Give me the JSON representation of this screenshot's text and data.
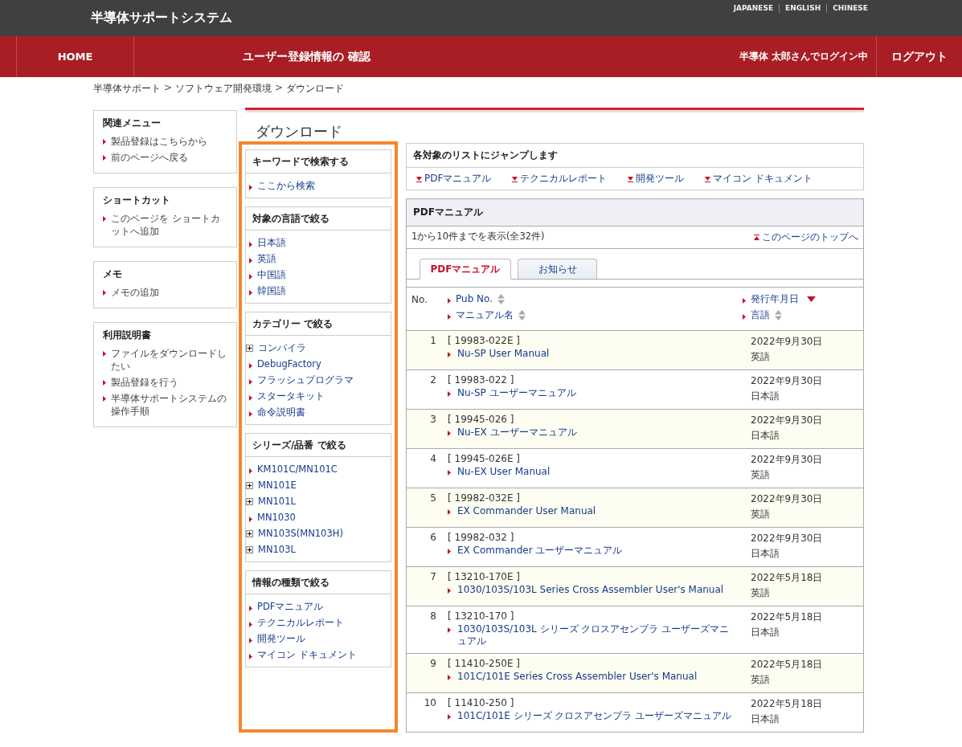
{
  "header": {
    "title": "半導体サポートシステム",
    "languages": [
      "JAPANESE",
      "ENGLISH",
      "CHINESE"
    ]
  },
  "nav": {
    "home": "HOME",
    "page_title": "ユーザー登録情報の 確認",
    "user_status": "半導体 太郎さんでログイン中",
    "logout": "ログアウト"
  },
  "breadcrumb": [
    {
      "label": "半導体サポート",
      "separator": ">"
    },
    {
      "label": "ソフトウェア開発環境",
      "separator": ">"
    },
    {
      "label": "ダウンロード"
    }
  ],
  "sidebar_boxes": [
    {
      "title": "関連メニュー",
      "items": [
        "製品登録はこちらから",
        "前のページへ戻る"
      ]
    },
    {
      "title": "ショートカット",
      "items": [
        "このページを ショートカットへ追加"
      ]
    },
    {
      "title": "メモ",
      "items": [
        "メモの追加"
      ]
    },
    {
      "title": "利用説明書",
      "items": [
        "ファイルをダウンロードしたい",
        "製品登録を行う",
        "半導体サポートシステムの操作手順"
      ]
    }
  ],
  "page_heading": "ダウンロード",
  "filters": [
    {
      "title": "キーワードで検索する",
      "items": [
        {
          "label": "ここから検索",
          "expandable": false
        }
      ]
    },
    {
      "title": "対象の言語で絞る",
      "items": [
        {
          "label": "日本語",
          "expandable": false
        },
        {
          "label": "英語",
          "expandable": false
        },
        {
          "label": "中国語",
          "expandable": false
        },
        {
          "label": "韓国語",
          "expandable": false
        }
      ]
    },
    {
      "title": "カテゴリー で絞る",
      "items": [
        {
          "label": "コンパイラ",
          "expandable": true
        },
        {
          "label": "DebugFactory",
          "expandable": false
        },
        {
          "label": "フラッシュプログラマ",
          "expandable": false
        },
        {
          "label": "スタータキット",
          "expandable": false
        },
        {
          "label": "命令説明書",
          "expandable": false
        }
      ]
    },
    {
      "title": "シリーズ/品番 で絞る",
      "items": [
        {
          "label": "KM101C/MN101C",
          "expandable": false
        },
        {
          "label": "MN101E",
          "expandable": true
        },
        {
          "label": "MN101L",
          "expandable": true
        },
        {
          "label": "MN1030",
          "expandable": false
        },
        {
          "label": "MN103S(MN103H)",
          "expandable": true
        },
        {
          "label": "MN103L",
          "expandable": true
        }
      ]
    },
    {
      "title": "情報の種類で絞る",
      "items": [
        {
          "label": "PDFマニュアル",
          "expandable": false
        },
        {
          "label": "テクニカルレポート",
          "expandable": false
        },
        {
          "label": "開発ツール",
          "expandable": false
        },
        {
          "label": "マイコン ドキュメント",
          "expandable": false
        }
      ]
    }
  ],
  "jump_box": {
    "title": "各対象のリストにジャンプします",
    "links": [
      "PDFマニュアル",
      "テクニカルレポート",
      "開発ツール",
      "マイコン ドキュメント"
    ]
  },
  "list_panel": {
    "title": "PDFマニュアル",
    "count": "1から10件までを表示(全32件)",
    "top_link": "このページのトップへ",
    "tabs": [
      {
        "label": "PDFマニュアル",
        "selected": true
      },
      {
        "label": "お知らせ",
        "selected": false
      }
    ],
    "no_column": "No.",
    "sort_columns": [
      {
        "label": "Pub No.",
        "sorted": false
      },
      {
        "label": "マニュアル名",
        "sorted": false
      },
      {
        "label": "発行年月日",
        "sorted": true
      },
      {
        "label": "言語",
        "sorted": false
      }
    ]
  },
  "rows": [
    {
      "no": "1",
      "pub_no": "[ 19983-022E ]",
      "name": "Nu-SP User Manual",
      "date": "2022年9月30日",
      "language": "英語"
    },
    {
      "no": "2",
      "pub_no": "[ 19983-022 ]",
      "name": "Nu-SP ユーザーマニュアル",
      "date": "2022年9月30日",
      "language": "日本語"
    },
    {
      "no": "3",
      "pub_no": "[ 19945-026 ]",
      "name": "Nu-EX ユーザーマニュアル",
      "date": "2022年9月30日",
      "language": "日本語"
    },
    {
      "no": "4",
      "pub_no": "[ 19945-026E ]",
      "name": "Nu-EX User Manual",
      "date": "2022年9月30日",
      "language": "英語"
    },
    {
      "no": "5",
      "pub_no": "[ 19982-032E ]",
      "name": "EX Commander User Manual",
      "date": "2022年9月30日",
      "language": "英語"
    },
    {
      "no": "6",
      "pub_no": "[ 19982-032 ]",
      "name": "EX Commander ユーザーマニュアル",
      "date": "2022年9月30日",
      "language": "日本語"
    },
    {
      "no": "7",
      "pub_no": "[ 13210-170E ]",
      "name": "1030/103S/103L Series Cross Assembler User's Manual",
      "date": "2022年5月18日",
      "language": "英語"
    },
    {
      "no": "8",
      "pub_no": "[ 13210-170 ]",
      "name": "1030/103S/103L シリーズ クロスアセンブラ ユーザーズマニュアル",
      "date": "2022年5月18日",
      "language": "日本語"
    },
    {
      "no": "9",
      "pub_no": "[ 11410-250E ]",
      "name": "101C/101E Series Cross Assembler User's Manual",
      "date": "2022年5月18日",
      "language": "英語"
    },
    {
      "no": "10",
      "pub_no": "[ 11410-250 ]",
      "name": "101C/101E シリーズ クロスアセンブラ ユーザーズマニュアル",
      "date": "2022年5月18日",
      "language": "日本語"
    }
  ]
}
